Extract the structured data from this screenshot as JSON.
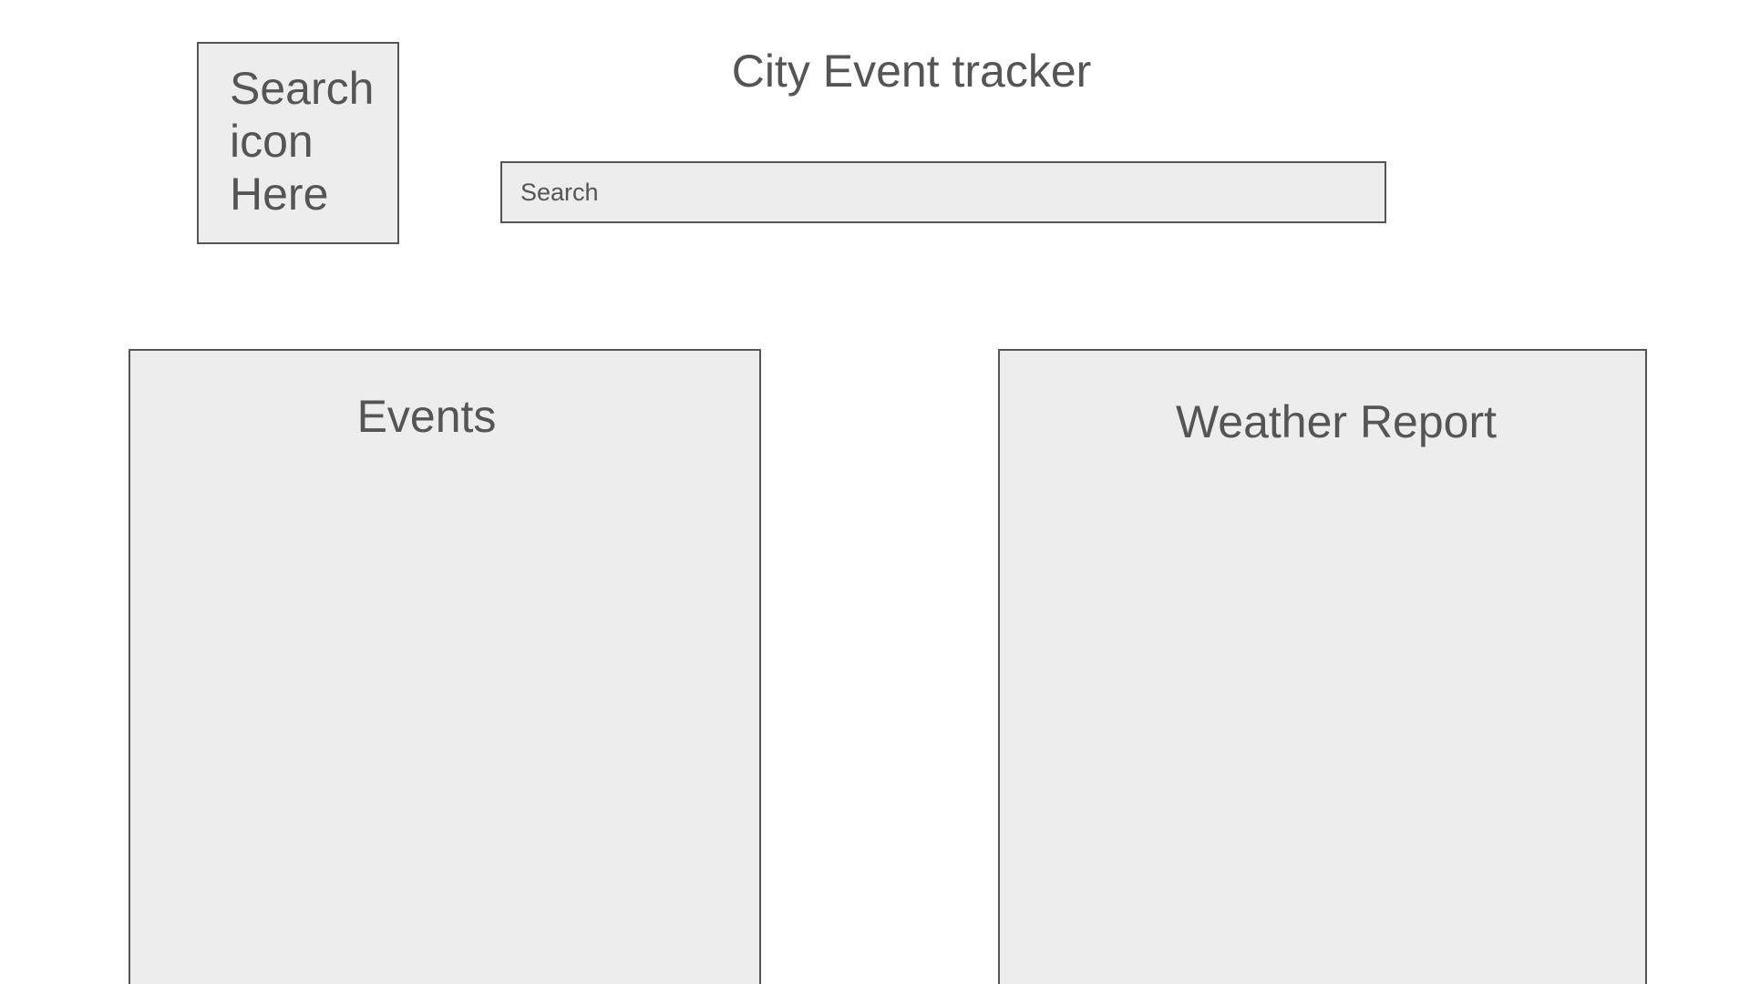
{
  "header": {
    "title": "City Event tracker",
    "search_icon_placeholder": "Search\nicon\nHere"
  },
  "search": {
    "placeholder": "Search",
    "value": ""
  },
  "events_panel": {
    "title": "Events"
  },
  "weather_panel": {
    "title": "Weather Report"
  },
  "colors": {
    "background": "#ffffff",
    "panel_fill": "#ededed",
    "border": "#555555",
    "text": "#555555"
  }
}
